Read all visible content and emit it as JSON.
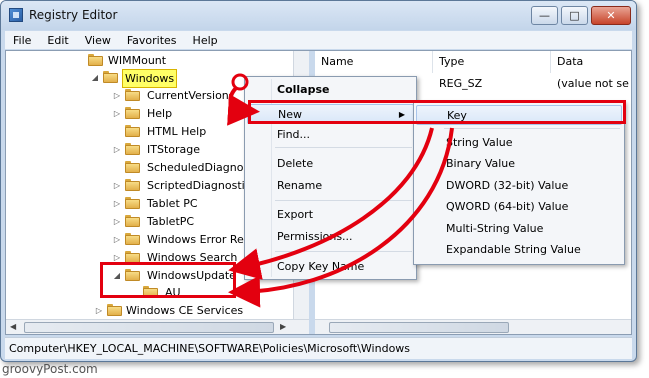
{
  "window": {
    "title": "Registry Editor",
    "minimize_glyph": "—",
    "maximize_glyph": "□",
    "close_glyph": "✕"
  },
  "menubar": [
    "File",
    "Edit",
    "View",
    "Favorites",
    "Help"
  ],
  "tree": {
    "items": [
      {
        "label": "WIMMount",
        "expander": ""
      },
      {
        "label": "Windows",
        "expander": "◢",
        "selected": true
      },
      {
        "label": "CurrentVersion",
        "expander": "▷"
      },
      {
        "label": "Help",
        "expander": "▷"
      },
      {
        "label": "HTML Help",
        "expander": ""
      },
      {
        "label": "ITStorage",
        "expander": "▷"
      },
      {
        "label": "ScheduledDiagnost",
        "expander": ""
      },
      {
        "label": "ScriptedDiagnostics",
        "expander": "▷"
      },
      {
        "label": "Tablet PC",
        "expander": "▷"
      },
      {
        "label": "TabletPC",
        "expander": "▷"
      },
      {
        "label": "Windows Error Repo",
        "expander": "▷"
      },
      {
        "label": "Windows Search",
        "expander": "▷"
      },
      {
        "label": "WindowsUpdate",
        "expander": "◢"
      },
      {
        "label": "AU",
        "expander": ""
      },
      {
        "label": "Windows CE Services",
        "expander": "▷"
      }
    ]
  },
  "values": {
    "columns": [
      "Name",
      "Type",
      "Data"
    ],
    "row": {
      "type": "REG_SZ",
      "data": "(value not se"
    }
  },
  "context_menu": {
    "items": [
      "Collapse",
      "New",
      "Find...",
      "Delete",
      "Rename",
      "Export",
      "Permissions...",
      "Copy Key Name"
    ],
    "submenu_arrow": "▶"
  },
  "submenu": {
    "items": [
      "Key",
      "String Value",
      "Binary Value",
      "DWORD (32-bit) Value",
      "QWORD (64-bit) Value",
      "Multi-String Value",
      "Expandable String Value"
    ]
  },
  "statusbar": {
    "path": "Computer\\HKEY_LOCAL_MACHINE\\SOFTWARE\\Policies\\Microsoft\\Windows"
  },
  "watermark": "groovyPost.com",
  "colors": {
    "annotation_red": "#e3000f",
    "selection_yellow": "#ffff66",
    "chrome_blue": "#c9d9ec"
  }
}
